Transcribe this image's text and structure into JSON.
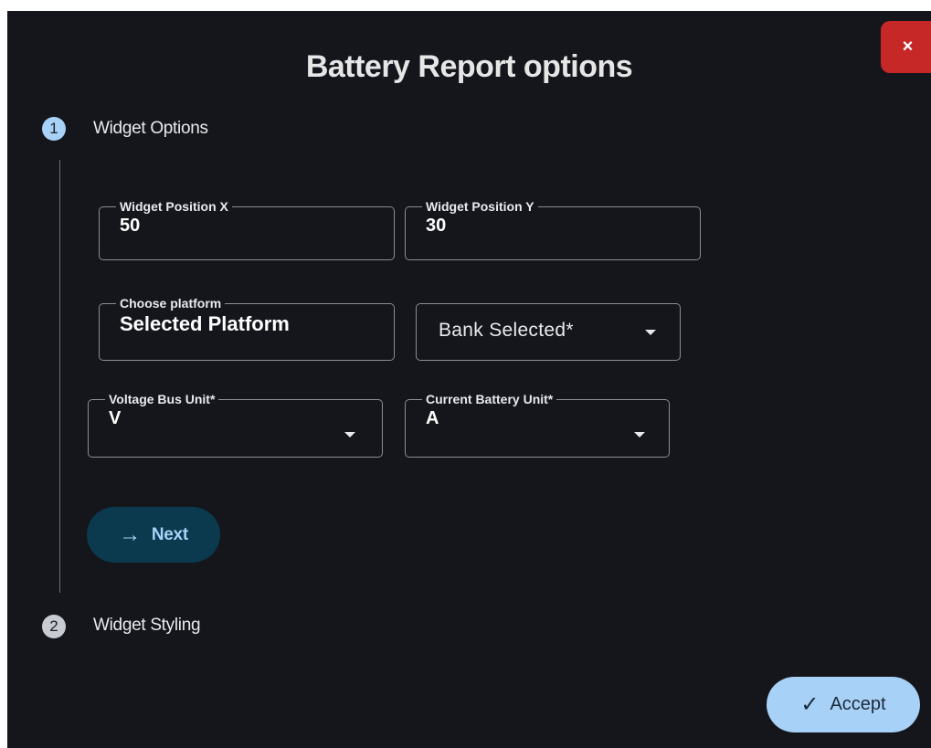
{
  "dialog": {
    "title": "Battery Report options",
    "close_label": "×",
    "accept_label": "Accept"
  },
  "steps": [
    {
      "number": "1",
      "label": "Widget Options"
    },
    {
      "number": "2",
      "label": "Widget Styling"
    }
  ],
  "fields": {
    "position_x": {
      "label": "Widget Position X",
      "value": "50"
    },
    "position_y": {
      "label": "Widget Position Y",
      "value": "30"
    },
    "platform": {
      "label": "Choose platform",
      "value": "Selected Platform"
    },
    "bank": {
      "placeholder": "Bank Selected*"
    },
    "voltage_unit": {
      "label": "Voltage Bus Unit*",
      "value": "V"
    },
    "current_unit": {
      "label": "Current Battery Unit*",
      "value": "A"
    }
  },
  "buttons": {
    "next_label": "Next"
  },
  "icons": {
    "next": "arrow-right-icon",
    "accept": "check-icon",
    "close": "close-icon",
    "select": "chevron-down-icon"
  },
  "colors": {
    "background": "#14161b",
    "accent": "#a8d1f7",
    "close": "#c62828",
    "next_button": "#0b3a4e"
  }
}
